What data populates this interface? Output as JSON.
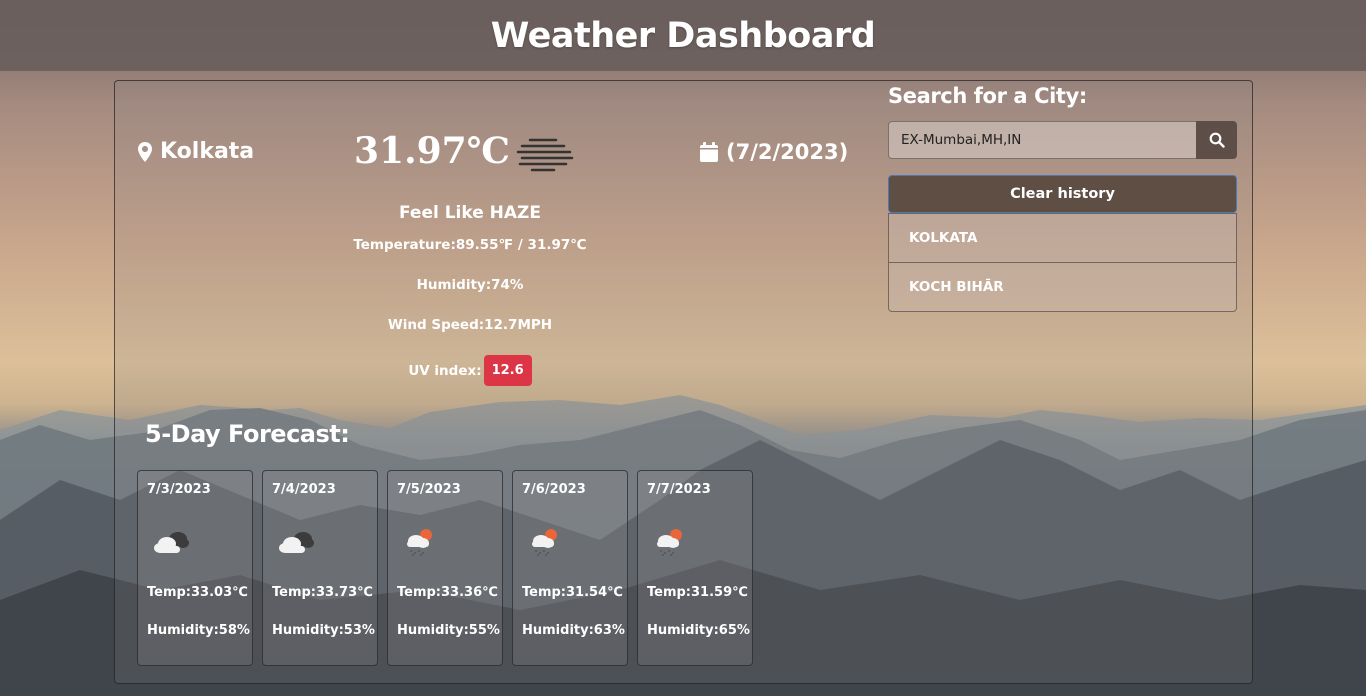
{
  "header": {
    "title": "Weather Dashboard"
  },
  "current": {
    "city": "Kolkata",
    "temperature": "31.97℃",
    "date": "(7/2/2023)",
    "icon": "haze-icon",
    "feel": "Feel Like HAZE",
    "temperature_detail": "Temperature:89.55℉ / 31.97℃",
    "humidity": "Humidity:74%",
    "wind": "Wind Speed:12.7MPH",
    "uv_label": "UV index:",
    "uv_value": "12.6",
    "uv_color": "#dc3545"
  },
  "forecast": {
    "title": "5-Day Forecast:",
    "days": [
      {
        "date": "7/3/2023",
        "icon": "cloudy-icon",
        "temp": "Temp:33.03℃",
        "humidity": "Humidity:58%"
      },
      {
        "date": "7/4/2023",
        "icon": "cloudy-icon",
        "temp": "Temp:33.73℃",
        "humidity": "Humidity:53%"
      },
      {
        "date": "7/5/2023",
        "icon": "rain-sun-icon",
        "temp": "Temp:33.36℃",
        "humidity": "Humidity:55%"
      },
      {
        "date": "7/6/2023",
        "icon": "rain-sun-icon",
        "temp": "Temp:31.54℃",
        "humidity": "Humidity:63%"
      },
      {
        "date": "7/7/2023",
        "icon": "rain-sun-icon",
        "temp": "Temp:31.59℃",
        "humidity": "Humidity:65%"
      }
    ]
  },
  "search": {
    "title": "Search for a City:",
    "value": "EX-Mumbai,MH,IN",
    "clear_label": "Clear history",
    "history": [
      "KOLKATA",
      "KOCH BIHĀR"
    ]
  }
}
